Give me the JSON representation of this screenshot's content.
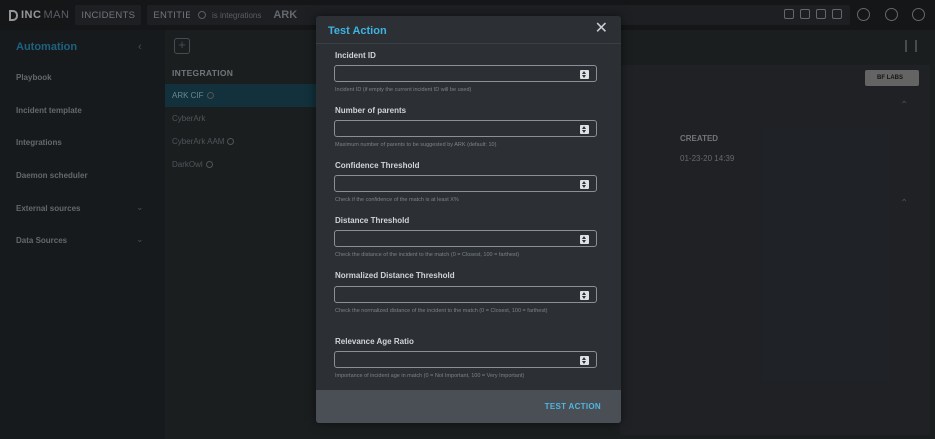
{
  "app": {
    "logo_text": "INC",
    "logo_suffix": "MAN",
    "nav": [
      "INCIDENTS",
      "ENTITIES"
    ],
    "search_placeholder": "is integrations",
    "search_chip": "ARK"
  },
  "sidebar": {
    "title": "Automation",
    "items": [
      {
        "label": "Playbook"
      },
      {
        "label": "Incident template"
      },
      {
        "label": "Integrations"
      },
      {
        "label": "Daemon scheduler"
      },
      {
        "label": "External sources"
      },
      {
        "label": "Data Sources"
      }
    ]
  },
  "integrations": {
    "header": "INTEGRATION",
    "rows": [
      "ARK CIF",
      "CyberArk",
      "CyberArk AAM",
      "DarkOwl"
    ]
  },
  "detail": {
    "logo_text": "BF LABS",
    "created_header": "CREATED",
    "created_value": "01-23-20 14:39"
  },
  "modal": {
    "title": "Test Action",
    "fields": [
      {
        "label": "Incident ID",
        "value": "",
        "help": "Incident ID (if empty the current incident ID will be used)"
      },
      {
        "label": "Number of parents",
        "value": "",
        "help": "Maximum number of parents to be suggested by ARK (default: 10)"
      },
      {
        "label": "Confidence Threshold",
        "value": "",
        "help": "Check if the confidence of the match is at least X%"
      },
      {
        "label": "Distance Threshold",
        "value": "",
        "help": "Check the distance of the incident to the match (0 = Closest, 100 = farthest)"
      },
      {
        "label": "Normalized Distance Threshold",
        "value": "",
        "help": "Check the normalized distance of the incident to the match (0 = Closest, 100 = farthest)"
      },
      {
        "label": "Relevance Age Ratio",
        "value": "",
        "help": "Importance of incident age in match (0 = Not Important, 100 = Very Important)"
      }
    ],
    "submit_label": "TEST ACTION"
  }
}
